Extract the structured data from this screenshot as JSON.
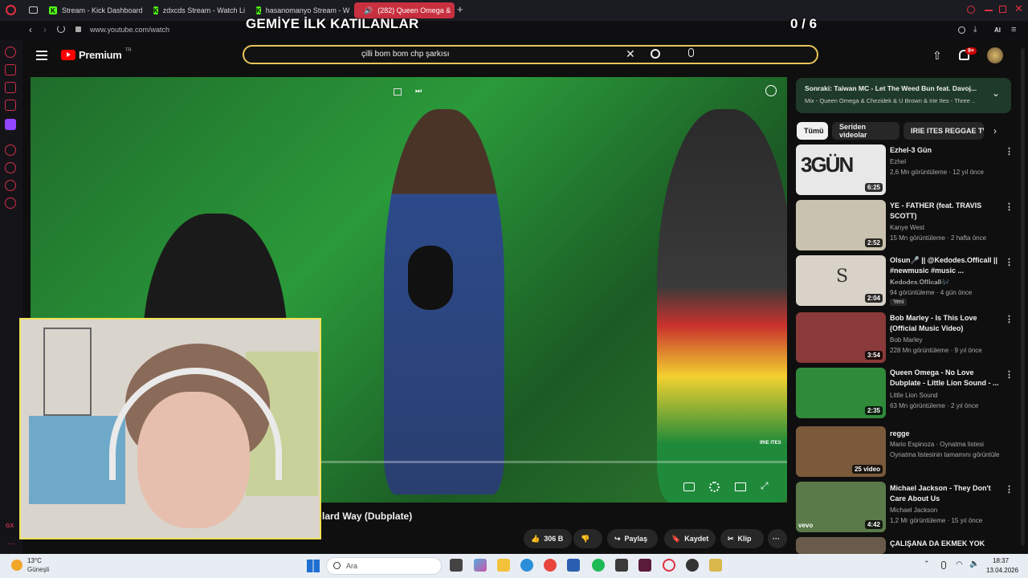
{
  "browser": {
    "tabs": [
      {
        "label": "Stream - Kick Dashboard"
      },
      {
        "label": "zdxcds Stream - Watch Li"
      },
      {
        "label": "hasanomanyo Stream - W"
      },
      {
        "label": "(282) Queen Omega &"
      }
    ],
    "url": "www.youtube.com/watch",
    "ai_label": "AI"
  },
  "stream_overlay": {
    "title": "GEMİYE İLK KATILANLAR",
    "counter": "0 / 6"
  },
  "youtube": {
    "logo": "Premium",
    "region": "TR",
    "search": {
      "value": "çilli bom bom chp şarkısı"
    },
    "notifications": "9+",
    "video_title": "lard Way (Dubplate)",
    "watermark": "IRIE ITES",
    "actions": {
      "likes": "306 B",
      "share": "Paylaş",
      "save": "Kaydet",
      "clip": "Klip"
    },
    "up_next": {
      "label": "Sonraki:",
      "title": "Taiwan MC - Let The Weed Bun feat. Davoj...",
      "subtitle": "Mix - Queen Omega & Chezidek & U Brown & Irie Ites - Three ..."
    },
    "chips": [
      "Tümü",
      "Seriden videolar",
      "IRIE ITES REGGAE TV"
    ],
    "recommendations": [
      {
        "title": "Ezhel-3 Gün",
        "channel": "Ezhel",
        "meta": "2,6 Mn görüntüleme · 12 yıl önce",
        "duration": "6:25",
        "thumb_text": "3GÜN",
        "thumb_color": "#e8e8e8"
      },
      {
        "title": "YE - FATHER (feat. TRAVIS SCOTT)",
        "channel": "Kanye West",
        "meta": "15 Mn görüntüleme · 2 hafta önce",
        "duration": "2:52",
        "thumb_color": "#c9c2ae"
      },
      {
        "title": "Olsun🎤 || @Kedodes.Officall || #newmusic #music ...",
        "channel": "𝐊𝐞𝐝𝐨𝐝𝐞𝐬.𝐎𝐟𝐟𝐢𝐜𝐚𝐥𝐥🎶",
        "meta": "94 görüntüleme · 4 gün önce",
        "badge": "Yeni",
        "duration": "2:04",
        "thumb_text": "S",
        "thumb_color": "#d9d2c8"
      },
      {
        "title": "Bob Marley - Is This Love (Official Music Video)",
        "channel": "Bob Marley",
        "meta": "228 Mn görüntüleme · 9 yıl önce",
        "duration": "3:54",
        "thumb_color": "#8a3a3a"
      },
      {
        "title": "Queen Omega - No Love Dubplate - Little Lion Sound - ...",
        "channel": "Little Lion Sound",
        "meta": "63 Mn görüntüleme · 2 yıl önce",
        "duration": "2:35",
        "thumb_color": "#2f8a3a"
      },
      {
        "title": "regge",
        "channel": "Mario Espinoza · Oynatma listesi",
        "meta": "Oynatma listesinin tamamını görüntüle",
        "duration": "25 video",
        "thumb_color": "#7a5a3a"
      },
      {
        "title": "Michael Jackson - They Don't Care About Us",
        "channel": "Michael Jackson",
        "meta": "1,2 Mr görüntüleme · 15 yıl önce",
        "duration": "4:42",
        "thumb_text": "vevo",
        "thumb_color": "#5a7a4a"
      },
      {
        "title": "ÇALIŞANA DA EKMEK YOK",
        "channel": "",
        "meta": "",
        "thumb_color": "#6a5a4a"
      }
    ]
  },
  "taskbar": {
    "weather_temp": "13°C",
    "weather_desc": "Güneşli",
    "search_placeholder": "Ara",
    "time": "18:37",
    "date": "13.04.2026"
  },
  "colors": {
    "accent_red": "#c8303f",
    "yt_red": "#ff0000",
    "highlight_yellow": "#e8c55a"
  }
}
